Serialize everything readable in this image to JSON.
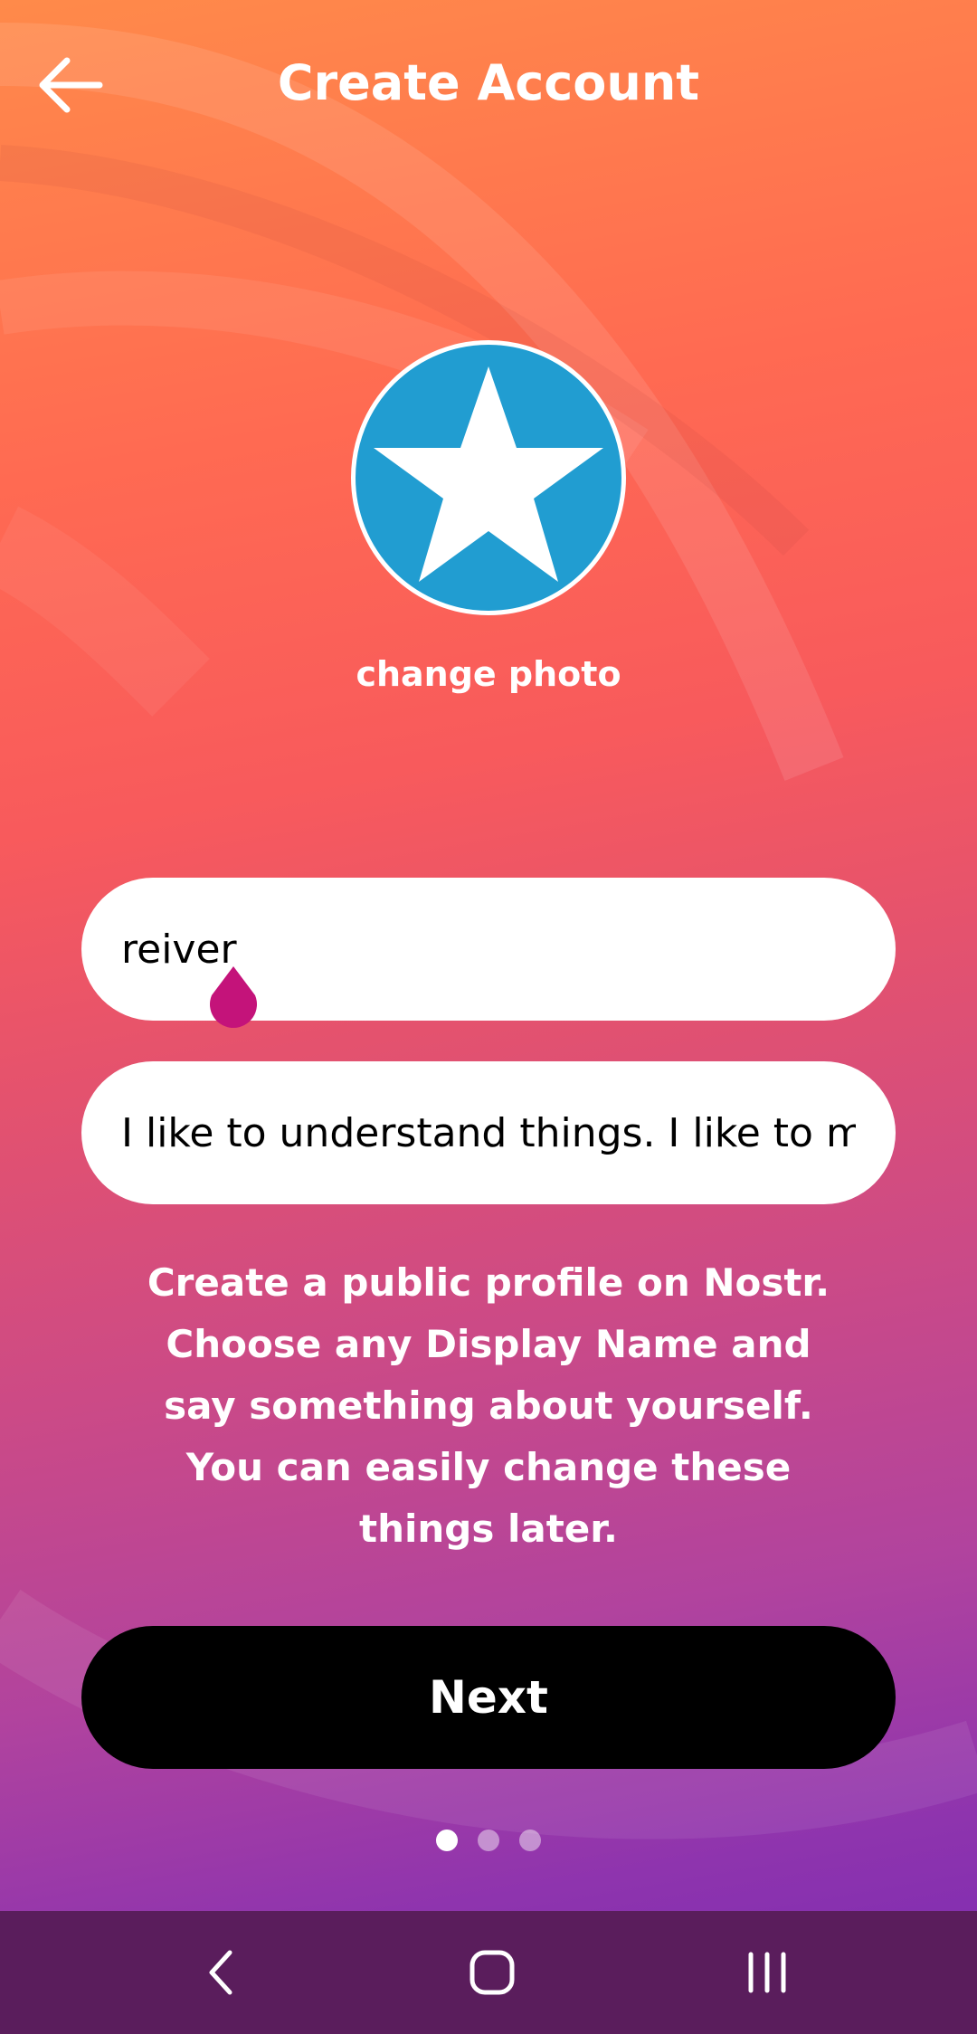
{
  "header": {
    "title": "Create Account"
  },
  "profile": {
    "change_photo_label": "change photo"
  },
  "form": {
    "display_name_value": "reiver",
    "about_value": "I like to understand things. I like to mak"
  },
  "description": "Create a public profile on Nostr. Choose any Display Name and say something about yourself. You can easily change these things later.",
  "actions": {
    "next_label": "Next"
  },
  "pagination": {
    "total": 3,
    "current": 1
  },
  "icons": {
    "back": "arrow-left-icon",
    "avatar": "star-icon",
    "nav_back": "chevron-left-icon",
    "nav_home": "home-icon",
    "nav_recents": "recents-icon"
  },
  "colors": {
    "avatar_bg": "#219dd1",
    "cursor_handle": "#c4137a",
    "navbar_bg": "#5a1d5c",
    "button_bg": "#000000"
  }
}
